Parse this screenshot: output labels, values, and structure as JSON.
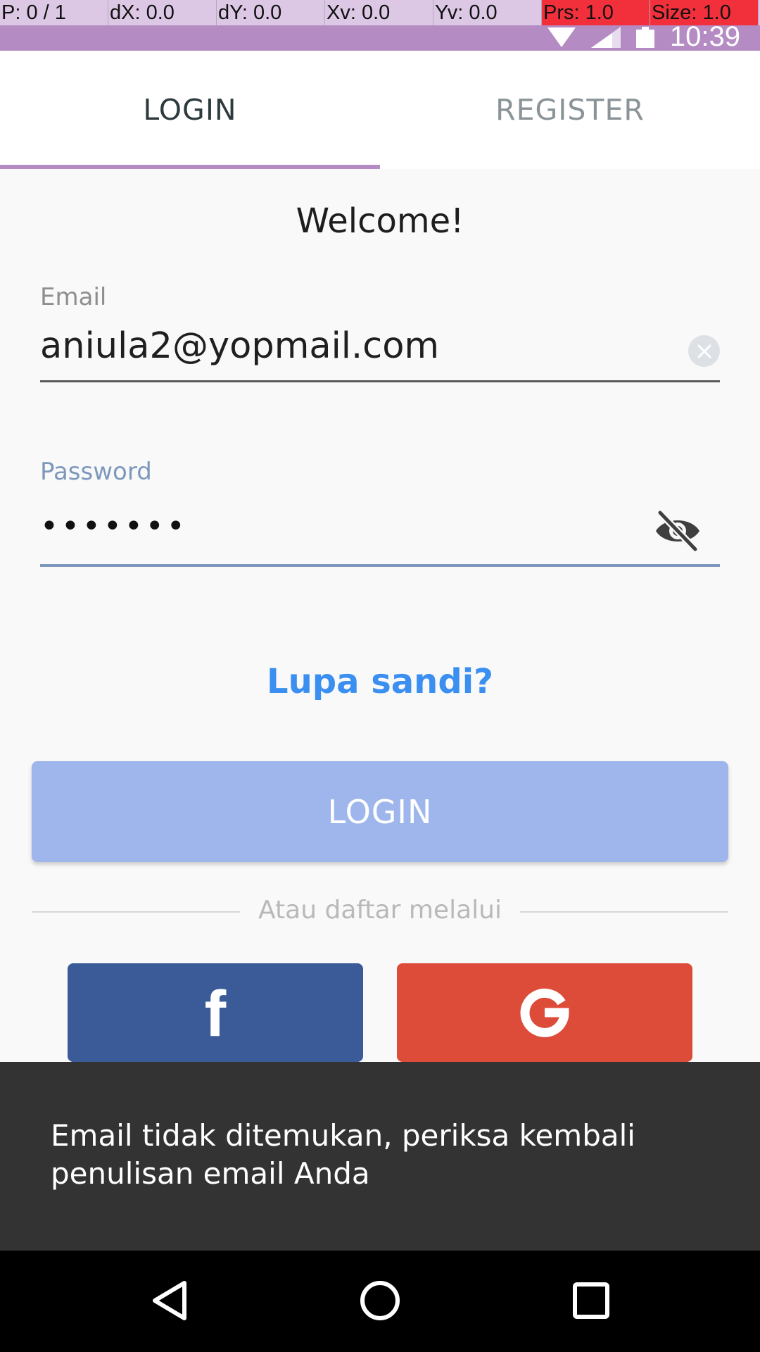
{
  "debug_overlay": {
    "pointer": "P: 0 / 1",
    "dx": "dX: 0.0",
    "dy": "dY: 0.0",
    "xv": "Xv: 0.0",
    "yv": "Yv: 0.0",
    "pressure": "Prs: 1.0",
    "size": "Size: 1.0"
  },
  "status_bar": {
    "time": "10:39",
    "color": "#b48bc2"
  },
  "tabs": [
    {
      "label": "LOGIN",
      "active": true
    },
    {
      "label": "REGISTER",
      "active": false
    }
  ],
  "form": {
    "welcome": "Welcome!",
    "email_label": "Email",
    "email_value": "aniula2@yopmail.com",
    "password_label": "Password",
    "password_value": "•••••••",
    "forgot_link": "Lupa sandi?",
    "login_button": "LOGIN",
    "divider_text": "Atau daftar melalui"
  },
  "social": {
    "facebook_icon": "facebook-icon",
    "facebook_color": "#3b5a98",
    "google_icon": "google-icon",
    "google_color": "#dd4b39"
  },
  "snackbar": {
    "message": "Email tidak ditemukan, periksa kembali penulisan email Anda"
  },
  "colors": {
    "accent": "#b48bc2",
    "link": "#3b8ff0",
    "button": "#9eb6ec",
    "focus": "#7e98bd"
  }
}
